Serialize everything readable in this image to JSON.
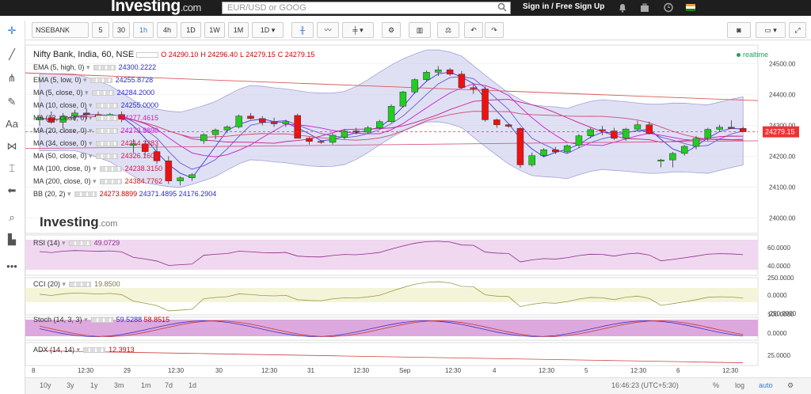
{
  "header": {
    "logo_text": "Investing",
    "logo_suffix": ".com",
    "search_placeholder": "EUR/USD or GOOG",
    "signin": "Sign in / Free Sign Up"
  },
  "toolbar": {
    "symbol": "NSEBANK",
    "intervals": [
      "5",
      "30",
      "1h",
      "4h",
      "1D",
      "1W",
      "1M"
    ],
    "active_interval": "1h",
    "range": "1D"
  },
  "chart": {
    "title": "Nifty Bank, India, 60, NSE",
    "ohlc": {
      "o": "O 24290.10",
      "h": "H 24296.40",
      "l": "L 24279.15",
      "c": "C 24279.15"
    },
    "realtime": "realtime",
    "last_price": "24279.15",
    "indicators": [
      {
        "name": "EMA (5, high, 0)",
        "value": "24300.2222",
        "color": "#2b2bc8"
      },
      {
        "name": "EMA (5, low, 0)",
        "value": "24255.8728",
        "color": "#2b2bc8"
      },
      {
        "name": "MA (5, close, 0)",
        "value": "24284.2000",
        "color": "#2b2bc8"
      },
      {
        "name": "MA (10, close, 0)",
        "value": "24255.0000",
        "color": "#2b2bc8"
      },
      {
        "name": "MA (13, close, 0)",
        "value": "24277.4615",
        "color": "#c81ec8"
      },
      {
        "name": "MA (20, close, 0)",
        "value": "24273.8899",
        "color": "#c81ec8"
      },
      {
        "name": "MA (34, close, 0)",
        "value": "24314.2383",
        "color": "#c81e50"
      },
      {
        "name": "MA (50, close, 0)",
        "value": "24326.1600",
        "color": "#c81e50"
      },
      {
        "name": "MA (100, close, 0)",
        "value": "24238.3150",
        "color": "#c81e50"
      },
      {
        "name": "MA (200, close, 0)",
        "value": "24384.7762",
        "color": "#c81e1e"
      }
    ],
    "bb": {
      "name": "BB (20, 2)",
      "mid": "24273.8899",
      "upper": "24371.4895",
      "lower": "24176.2904"
    },
    "price_ticks": [
      "24500.00",
      "24400.00",
      "24300.00",
      "24200.00",
      "24100.00",
      "24000.00"
    ],
    "rsi": {
      "name": "RSI (14)",
      "value": "49.0729",
      "ticks": [
        "60.0000",
        "40.0000"
      ]
    },
    "cci": {
      "name": "CCI (20)",
      "value": "19.8500",
      "ticks": [
        "250.0000",
        "0.0000",
        "-250.0000"
      ]
    },
    "stoch": {
      "name": "Stoch (14, 3, 3)",
      "k": "59.5288",
      "d": "58.8515",
      "ticks": [
        "100.0000",
        "0.0000"
      ]
    },
    "adx": {
      "name": "ADX (14, 14)",
      "value": "12.3913",
      "ticks": [
        "25.0000"
      ]
    },
    "time_labels": [
      "8",
      "12:30",
      "29",
      "12:30",
      "30",
      "12:30",
      "31",
      "12:30",
      "Sep",
      "12:30",
      "4",
      "12:30",
      "5",
      "12:30",
      "6",
      "12:30"
    ],
    "watermark": "Investing",
    "watermark_suffix": ".com"
  },
  "chart_data": {
    "type": "candlestick",
    "ylim": [
      23950,
      24560
    ],
    "candles": [
      [
        24318,
        24335,
        24300,
        24325
      ],
      [
        24325,
        24345,
        24305,
        24310
      ],
      [
        24310,
        24340,
        24290,
        24330
      ],
      [
        24330,
        24350,
        24315,
        24340
      ],
      [
        24340,
        24355,
        24320,
        24335
      ],
      [
        24335,
        24345,
        24318,
        24328
      ],
      [
        24328,
        24340,
        24315,
        24335
      ],
      [
        24335,
        24345,
        24310,
        24320
      ],
      [
        24235,
        24255,
        24210,
        24240
      ],
      [
        24240,
        24250,
        24200,
        24215
      ],
      [
        24215,
        24235,
        24175,
        24185
      ],
      [
        24185,
        24200,
        24110,
        24120
      ],
      [
        24120,
        24135,
        24105,
        24130
      ],
      [
        24130,
        24145,
        24120,
        24140
      ],
      [
        24250,
        24275,
        24240,
        24270
      ],
      [
        24270,
        24290,
        24255,
        24285
      ],
      [
        24285,
        24300,
        24275,
        24295
      ],
      [
        24295,
        24335,
        24290,
        24330
      ],
      [
        24330,
        24340,
        24318,
        24322
      ],
      [
        24322,
        24330,
        24300,
        24310
      ],
      [
        24310,
        24325,
        24295,
        24305
      ],
      [
        24305,
        24318,
        24295,
        24312
      ],
      [
        24332,
        24338,
        24262,
        24258
      ],
      [
        24258,
        24262,
        24238,
        24248
      ],
      [
        24248,
        24252,
        24240,
        24245
      ],
      [
        24245,
        24275,
        24238,
        24268
      ],
      [
        24262,
        24288,
        24255,
        24282
      ],
      [
        24282,
        24292,
        24270,
        24278
      ],
      [
        24278,
        24298,
        24272,
        24292
      ],
      [
        24292,
        24318,
        24288,
        24312
      ],
      [
        24312,
        24368,
        24308,
        24362
      ],
      [
        24362,
        24412,
        24358,
        24408
      ],
      [
        24408,
        24452,
        24402,
        24448
      ],
      [
        24448,
        24478,
        24442,
        24472
      ],
      [
        24472,
        24492,
        24460,
        24480
      ],
      [
        24480,
        24486,
        24460,
        24466
      ],
      [
        24466,
        24476,
        24418,
        24422
      ],
      [
        24422,
        24432,
        24402,
        24418
      ],
      [
        24418,
        24426,
        24312,
        24318
      ],
      [
        24318,
        24322,
        24292,
        24302
      ],
      [
        24302,
        24306,
        24292,
        24297
      ],
      [
        24290,
        24294,
        24162,
        24172
      ],
      [
        24172,
        24212,
        24166,
        24202
      ],
      [
        24202,
        24226,
        24197,
        24221
      ],
      [
        24221,
        24230,
        24207,
        24214
      ],
      [
        24214,
        24238,
        24210,
        24234
      ],
      [
        24236,
        24272,
        24226,
        24266
      ],
      [
        24266,
        24292,
        24258,
        24286
      ],
      [
        24286,
        24298,
        24268,
        24282
      ],
      [
        24282,
        24292,
        24252,
        24258
      ],
      [
        24258,
        24292,
        24250,
        24288
      ],
      [
        24288,
        24315,
        24280,
        24302
      ],
      [
        24302,
        24312,
        24270,
        24274
      ],
      [
        24184,
        24192,
        24164,
        24188
      ],
      [
        24188,
        24214,
        24164,
        24209
      ],
      [
        24209,
        24237,
        24202,
        24232
      ],
      [
        24232,
        24266,
        24222,
        24258
      ],
      [
        24258,
        24292,
        24250,
        24287
      ],
      [
        24287,
        24302,
        24278,
        24294
      ],
      [
        24294,
        24316,
        24288,
        24290
      ],
      [
        24290,
        24296,
        24279,
        24279
      ]
    ]
  }
}
